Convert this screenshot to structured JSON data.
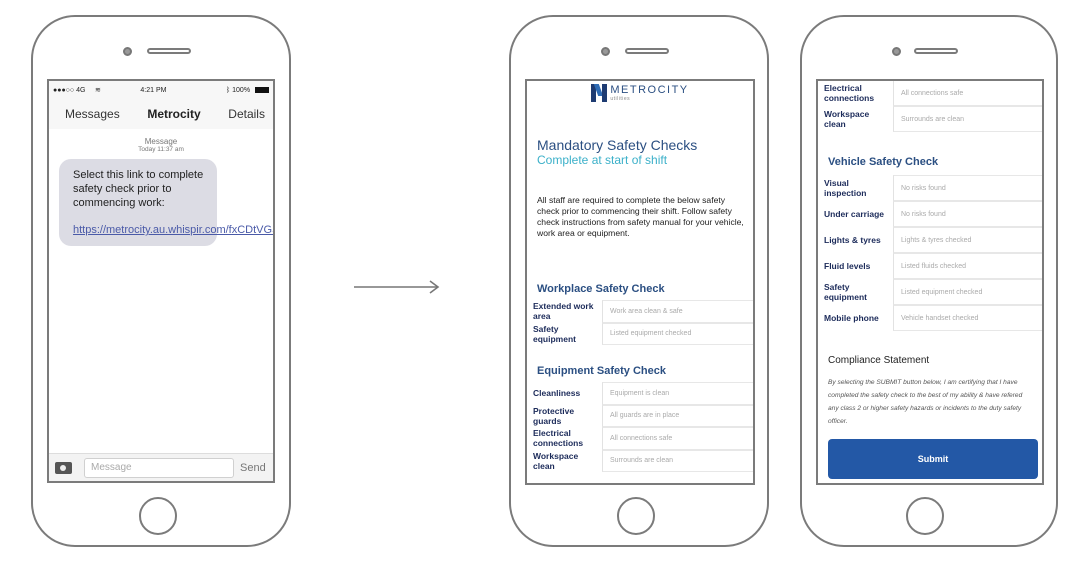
{
  "phone1": {
    "status_bar": {
      "carrier": "●●●○○ 4G",
      "wifi_icon": "wifi-icon",
      "time": "4:21 PM",
      "bluetooth_icon": "bluetooth-icon",
      "battery": "100%"
    },
    "nav": {
      "back_label": "Messages",
      "title": "Metrocity",
      "details_label": "Details"
    },
    "message_header": {
      "label": "Message",
      "timestamp": "Today  11:37 am"
    },
    "message": {
      "body": "Select this link to complete safety check prior to commencing work:",
      "link": "https://metrocity.au.whispir.com/fxCDtVGS"
    },
    "composer": {
      "camera_icon": "camera-icon",
      "placeholder": "Message",
      "send_label": "Send"
    }
  },
  "arrow": {
    "icon": "arrow-right-icon"
  },
  "phone2": {
    "logo": {
      "name": "METROCITY",
      "tagline": "utilities"
    },
    "title": "Mandatory Safety Checks",
    "subtitle": "Complete at start of shift",
    "intro": "All staff are required to complete the below safety check prior to commencing their shift. Follow safety check instructions from safety manual for your vehicle, work area or equipment.",
    "workplace": {
      "title": "Workplace Safety Check",
      "rows": [
        {
          "label": "Extended work area",
          "value": "Work area clean & safe"
        },
        {
          "label": "Safety equipment",
          "value": "Listed equipment checked"
        }
      ]
    },
    "equipment": {
      "title": "Equipment Safety Check",
      "rows": [
        {
          "label": "Cleanliness",
          "value": "Equipment is clean"
        },
        {
          "label": "Protective guards",
          "value": "All guards are in place"
        },
        {
          "label": "Electrical connections",
          "value": "All connections safe"
        },
        {
          "label": "Workspace clean",
          "value": "Surrounds are clean"
        }
      ]
    }
  },
  "phone3": {
    "top_rows": [
      {
        "label": "Electrical connections",
        "value": "All connections safe"
      },
      {
        "label": "Workspace clean",
        "value": "Surrounds are clean"
      }
    ],
    "vehicle": {
      "title": "Vehicle Safety Check",
      "rows": [
        {
          "label": "Visual inspection",
          "value": "No risks found"
        },
        {
          "label": "Under carriage",
          "value": "No risks found"
        },
        {
          "label": "Lights & tyres",
          "value": "Lights & tyres checked"
        },
        {
          "label": "Fluid levels",
          "value": "Listed fluids checked"
        },
        {
          "label": "Safety equipment",
          "value": "Listed equipment checked"
        },
        {
          "label": "Mobile phone",
          "value": "Vehicle handset checked"
        }
      ]
    },
    "compliance": {
      "title": "Compliance Statement",
      "text": "By selecting the SUBMIT button below, I am certifying that I have completed the safety check to the best of my ability & have refered any class 2 or higher safety hazards or incidents to the duty safety officer."
    },
    "submit_label": "Submit"
  },
  "colors": {
    "brand_navy": "#2b4f82",
    "brand_teal": "#3bb0c9",
    "label_navy": "#1c2b5a",
    "submit_blue": "#2358a6",
    "bubble_gray": "#dcdce4",
    "link_blue": "#4a5aa8",
    "frame_gray": "#7b7b7b"
  }
}
